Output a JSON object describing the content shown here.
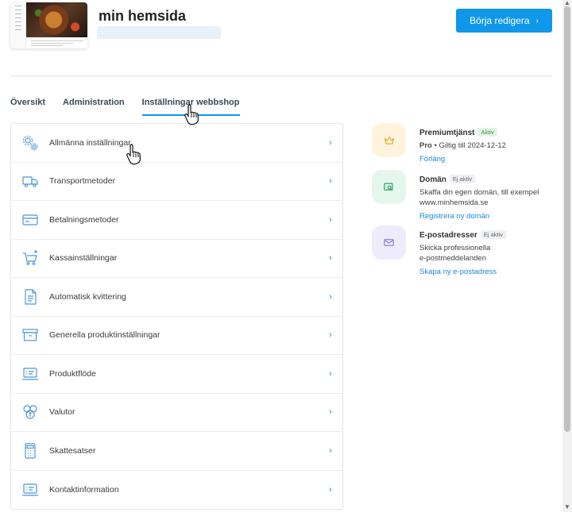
{
  "header": {
    "site_title": "min hemsida",
    "edit_button": "Börja redigera",
    "edit_button_chevron": "›"
  },
  "tabs": [
    {
      "label": "Översikt",
      "active": false
    },
    {
      "label": "Administration",
      "active": false
    },
    {
      "label": "Inställningar webbshop",
      "active": true
    }
  ],
  "settings": {
    "chevron": "›",
    "items": [
      {
        "label": "Allmänna inställningar",
        "icon": "gears-icon"
      },
      {
        "label": "Transportmetoder",
        "icon": "truck-icon"
      },
      {
        "label": "Betalningsmetoder",
        "icon": "card-icon"
      },
      {
        "label": "Kassainställningar",
        "icon": "cart-icon"
      },
      {
        "label": "Automatisk kvittering",
        "icon": "document-icon"
      },
      {
        "label": "Generella produktinställningar",
        "icon": "box-icon"
      },
      {
        "label": "Produktflöde",
        "icon": "laptop-list-icon"
      },
      {
        "label": "Valutor",
        "icon": "coins-icon"
      },
      {
        "label": "Skattesatser",
        "icon": "calculator-icon"
      },
      {
        "label": "Kontaktinformation",
        "icon": "laptop-contact-icon"
      }
    ]
  },
  "services": [
    {
      "title": "Premiumtjänst",
      "status": "Aktiv",
      "plan": "Pro",
      "validity": " • Giltig till 2024-12-12",
      "link": "Förläng",
      "icon": "crown-icon",
      "icon_bg": "#fff3dd",
      "icon_color": "#e2a72a"
    },
    {
      "title": "Domän",
      "status": "Ej aktiv",
      "desc_line1": "Skaffa din egen domän, till exempel",
      "desc_line2": "www.minhemsida.se",
      "link": "Registrera ny domän",
      "icon": "domain-search-icon",
      "icon_bg": "#e5f7ec",
      "icon_color": "#34a96a"
    },
    {
      "title": "E-postadresser",
      "status": "Ej aktiv",
      "desc_line1": "Skicka professionella",
      "desc_line2": "e-postmeddelanden",
      "link": "Skapa ny e-postadress",
      "icon": "envelope-icon",
      "icon_bg": "#eeecfa",
      "icon_color": "#8b83d6"
    }
  ],
  "colors": {
    "accent": "#0f98ea",
    "icon_blue": "#4a98d8"
  }
}
